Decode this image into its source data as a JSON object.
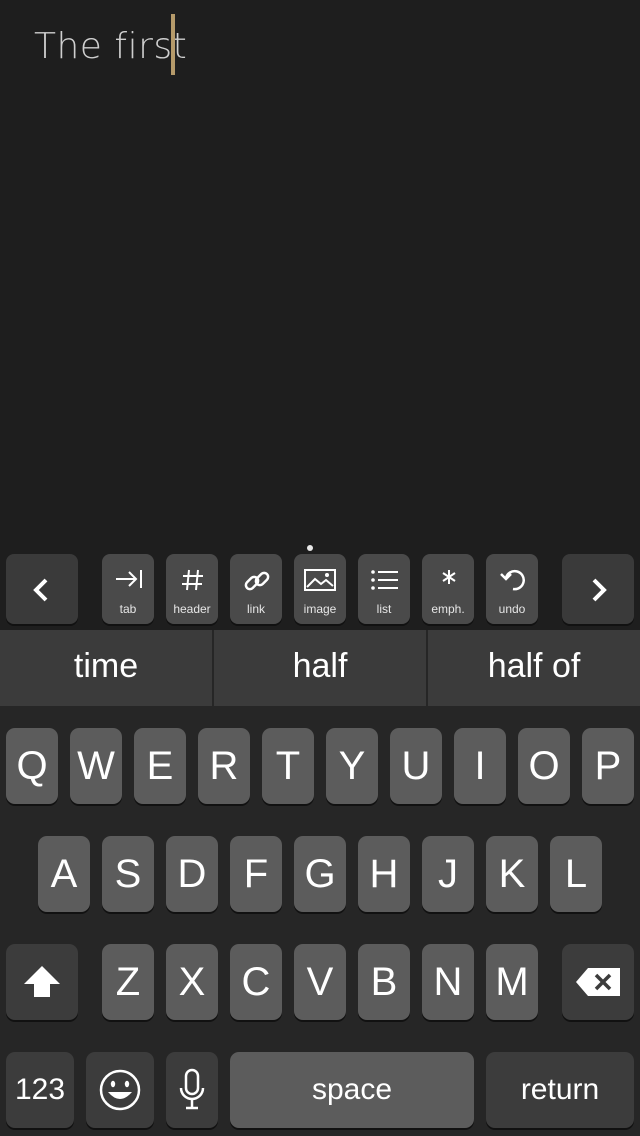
{
  "editor": {
    "text": "The first"
  },
  "toolbar": {
    "buttons": [
      {
        "label": "tab",
        "icon": "tab-icon"
      },
      {
        "label": "header",
        "icon": "hash-icon"
      },
      {
        "label": "link",
        "icon": "link-icon"
      },
      {
        "label": "image",
        "icon": "image-icon"
      },
      {
        "label": "list",
        "icon": "list-icon"
      },
      {
        "label": "emph.",
        "icon": "asterisk-icon"
      },
      {
        "label": "undo",
        "icon": "undo-icon"
      }
    ],
    "prev_icon": "chevron-left-icon",
    "next_icon": "chevron-right-icon"
  },
  "suggestions": [
    "time",
    "half",
    "half of"
  ],
  "keyboard": {
    "row1": [
      "Q",
      "W",
      "E",
      "R",
      "T",
      "Y",
      "U",
      "I",
      "O",
      "P"
    ],
    "row2": [
      "A",
      "S",
      "D",
      "F",
      "G",
      "H",
      "J",
      "K",
      "L"
    ],
    "row3": [
      "Z",
      "X",
      "C",
      "V",
      "B",
      "N",
      "M"
    ],
    "shift_icon": "shift-icon",
    "delete_icon": "backspace-icon",
    "numbers_label": "123",
    "emoji_icon": "emoji-icon",
    "mic_icon": "microphone-icon",
    "space_label": "space",
    "return_label": "return"
  },
  "colors": {
    "cursor": "#b59a6a",
    "background": "#1e1e1e"
  }
}
